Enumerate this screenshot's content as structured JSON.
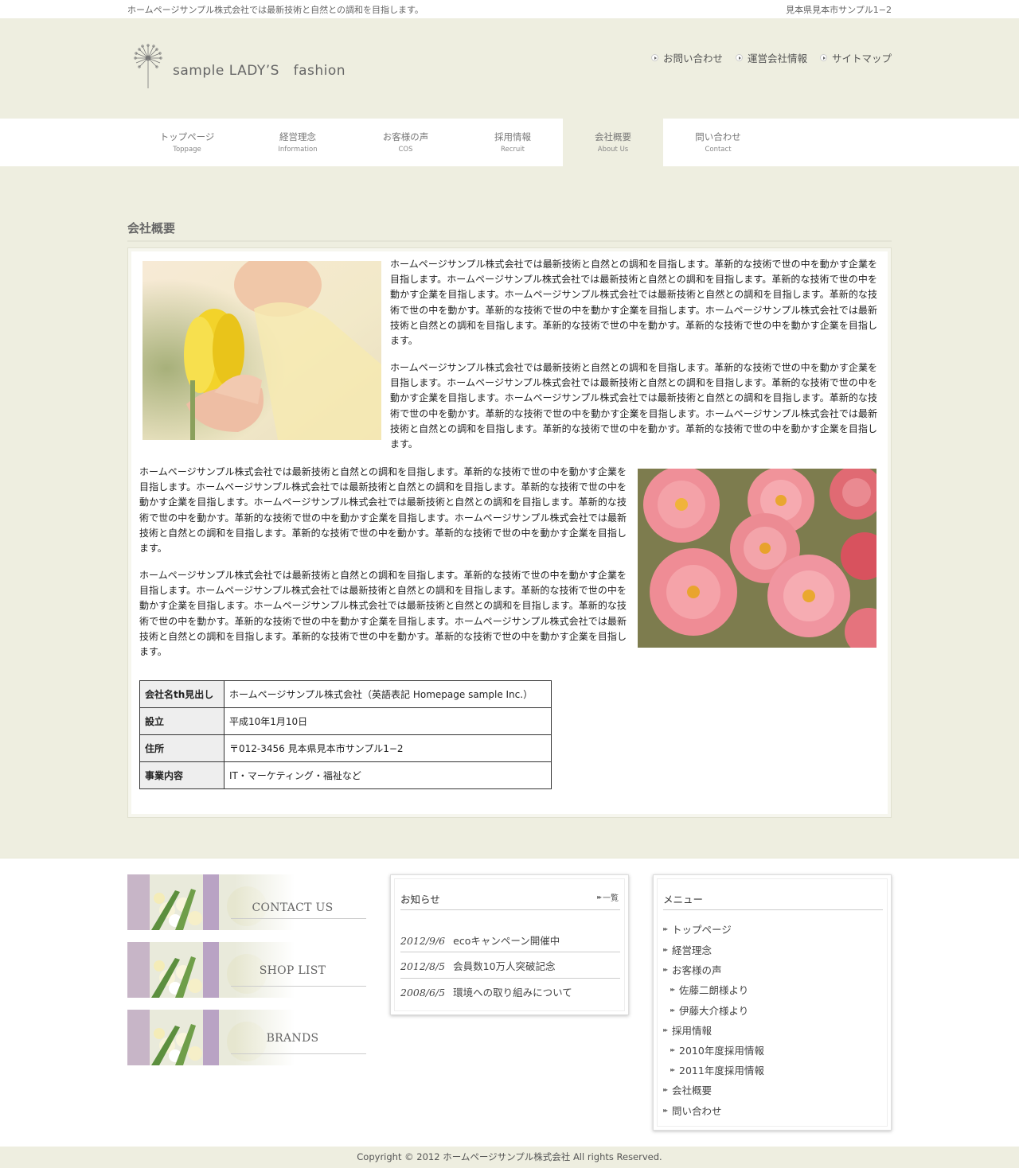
{
  "topbar": {
    "tagline": "ホームページサンプル株式会社では最新技術と自然との調和を目指します。",
    "address": "見本県見本市サンプル1−2"
  },
  "header": {
    "logo_text": "sample LADY’S   fashion",
    "links": [
      "お問い合わせ",
      "運営会社情報",
      "サイトマップ"
    ]
  },
  "nav": {
    "items": [
      {
        "jp": "トップページ",
        "en": "Toppage"
      },
      {
        "jp": "経営理念",
        "en": "Information"
      },
      {
        "jp": "お客様の声",
        "en": "COS"
      },
      {
        "jp": "採用情報",
        "en": "Recruit"
      },
      {
        "jp": "会社概要",
        "en": "About Us"
      },
      {
        "jp": "問い合わせ",
        "en": "Contact"
      }
    ],
    "active_index": 4
  },
  "main": {
    "title": "会社概要",
    "paragraph": "ホームページサンプル株式会社では最新技術と自然との調和を目指します。革新的な技術で世の中を動かす企業を目指します。ホームページサンプル株式会社では最新技術と自然との調和を目指します。革新的な技術で世の中を動かす企業を目指します。ホームページサンプル株式会社では最新技術と自然との調和を目指します。革新的な技術で世の中を動かす。革新的な技術で世の中を動かす企業を目指します。ホームページサンプル株式会社では最新技術と自然との調和を目指します。革新的な技術で世の中を動かす。革新的な技術で世の中を動かす企業を目指します。",
    "table": [
      {
        "label": "会社名th見出し",
        "value": "ホームページサンプル株式会社（英語表記 Homepage sample Inc.）"
      },
      {
        "label": "設立",
        "value": "平成10年1月10日"
      },
      {
        "label": "住所",
        "value": "〒012-3456 見本県見本市サンプル1−2"
      },
      {
        "label": "事業内容",
        "value": "IT・マーケティング・福祉など"
      }
    ]
  },
  "banners": [
    "CONTACT US",
    "SHOP LIST",
    "BRANDS"
  ],
  "news": {
    "title": "お知らせ",
    "more": "一覧",
    "items": [
      {
        "date": "2012/9/6",
        "text": "ecoキャンペーン開催中"
      },
      {
        "date": "2012/8/5",
        "text": "会員数10万人突破記念"
      },
      {
        "date": "2008/6/5",
        "text": "環境への取り組みについて"
      }
    ]
  },
  "menu": {
    "title": "メニュー",
    "items": [
      {
        "label": "トップページ",
        "level": 0
      },
      {
        "label": "経営理念",
        "level": 0
      },
      {
        "label": "お客様の声",
        "level": 0
      },
      {
        "label": "佐藤二朗様より",
        "level": 1
      },
      {
        "label": "伊藤大介様より",
        "level": 1
      },
      {
        "label": "採用情報",
        "level": 0
      },
      {
        "label": "2010年度採用情報",
        "level": 1
      },
      {
        "label": "2011年度採用情報",
        "level": 1
      },
      {
        "label": "会社概要",
        "level": 0
      },
      {
        "label": "問い合わせ",
        "level": 0
      }
    ]
  },
  "copyright": "Copyright © 2012 ホームページサンプル株式会社 All rights Reserved."
}
